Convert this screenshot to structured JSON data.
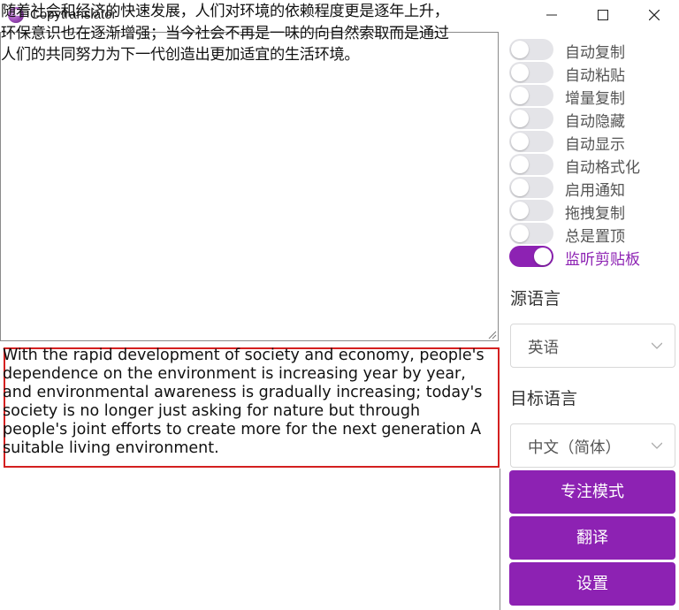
{
  "window": {
    "title": "Copytranslator"
  },
  "source": {
    "text": "随着社会和经济的快速发展，人们对环境的依赖程度更是逐年上升，\n环保意识也在逐渐增强；当今社会不再是一味的向自然索取而是通过\n人们的共同努力为下一代创造出更加适宜的生活环境。"
  },
  "result": {
    "text": "With the rapid development of society and economy, people's\ndependence on the environment is increasing year by year,\nand environmental awareness is gradually increasing; today's\nsociety is no longer just asking for nature but through\npeople's joint efforts to create more for the next generation  A\nsuitable living environment."
  },
  "toggles": [
    {
      "label": "自动复制",
      "on": false
    },
    {
      "label": "自动粘贴",
      "on": false
    },
    {
      "label": "增量复制",
      "on": false
    },
    {
      "label": "自动隐藏",
      "on": false
    },
    {
      "label": "自动显示",
      "on": false
    },
    {
      "label": "自动格式化",
      "on": false
    },
    {
      "label": "启用通知",
      "on": false
    },
    {
      "label": "拖拽复制",
      "on": false
    },
    {
      "label": "总是置顶",
      "on": false
    },
    {
      "label": "监听剪贴板",
      "on": true
    }
  ],
  "source_language": {
    "label": "源语言",
    "value": "英语"
  },
  "target_language": {
    "label": "目标语言",
    "value": "中文（简体）"
  },
  "buttons": {
    "focus_mode": "专注模式",
    "translate": "翻译",
    "settings": "设置"
  },
  "colors": {
    "accent": "#8d22b3",
    "highlight_border": "#d42020"
  }
}
